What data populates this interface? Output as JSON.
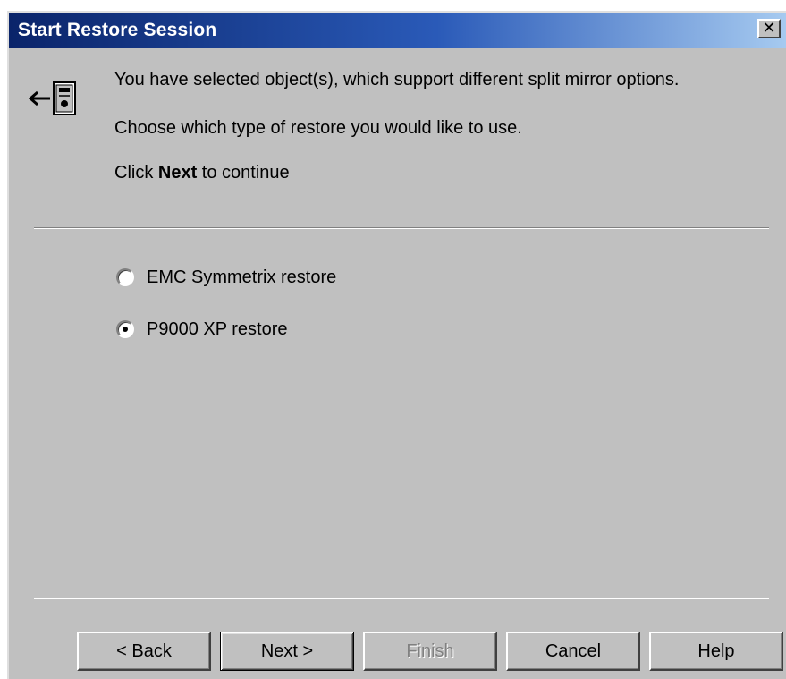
{
  "window": {
    "title": "Start Restore Session",
    "close_glyph": "✕"
  },
  "intro": {
    "line1": "You have selected object(s), which support different split mirror options.",
    "line2": "Choose which type of restore you would like to use.",
    "line3_prefix": "Click ",
    "line3_bold": "Next",
    "line3_suffix": " to continue"
  },
  "options": [
    {
      "label": "EMC Symmetrix restore",
      "selected": false
    },
    {
      "label": "P9000 XP restore",
      "selected": true
    }
  ],
  "buttons": {
    "back": "< Back",
    "next": "Next >",
    "finish": "Finish",
    "cancel": "Cancel",
    "help": "Help"
  },
  "icons": {
    "wizard": "restore-wizard-icon"
  }
}
